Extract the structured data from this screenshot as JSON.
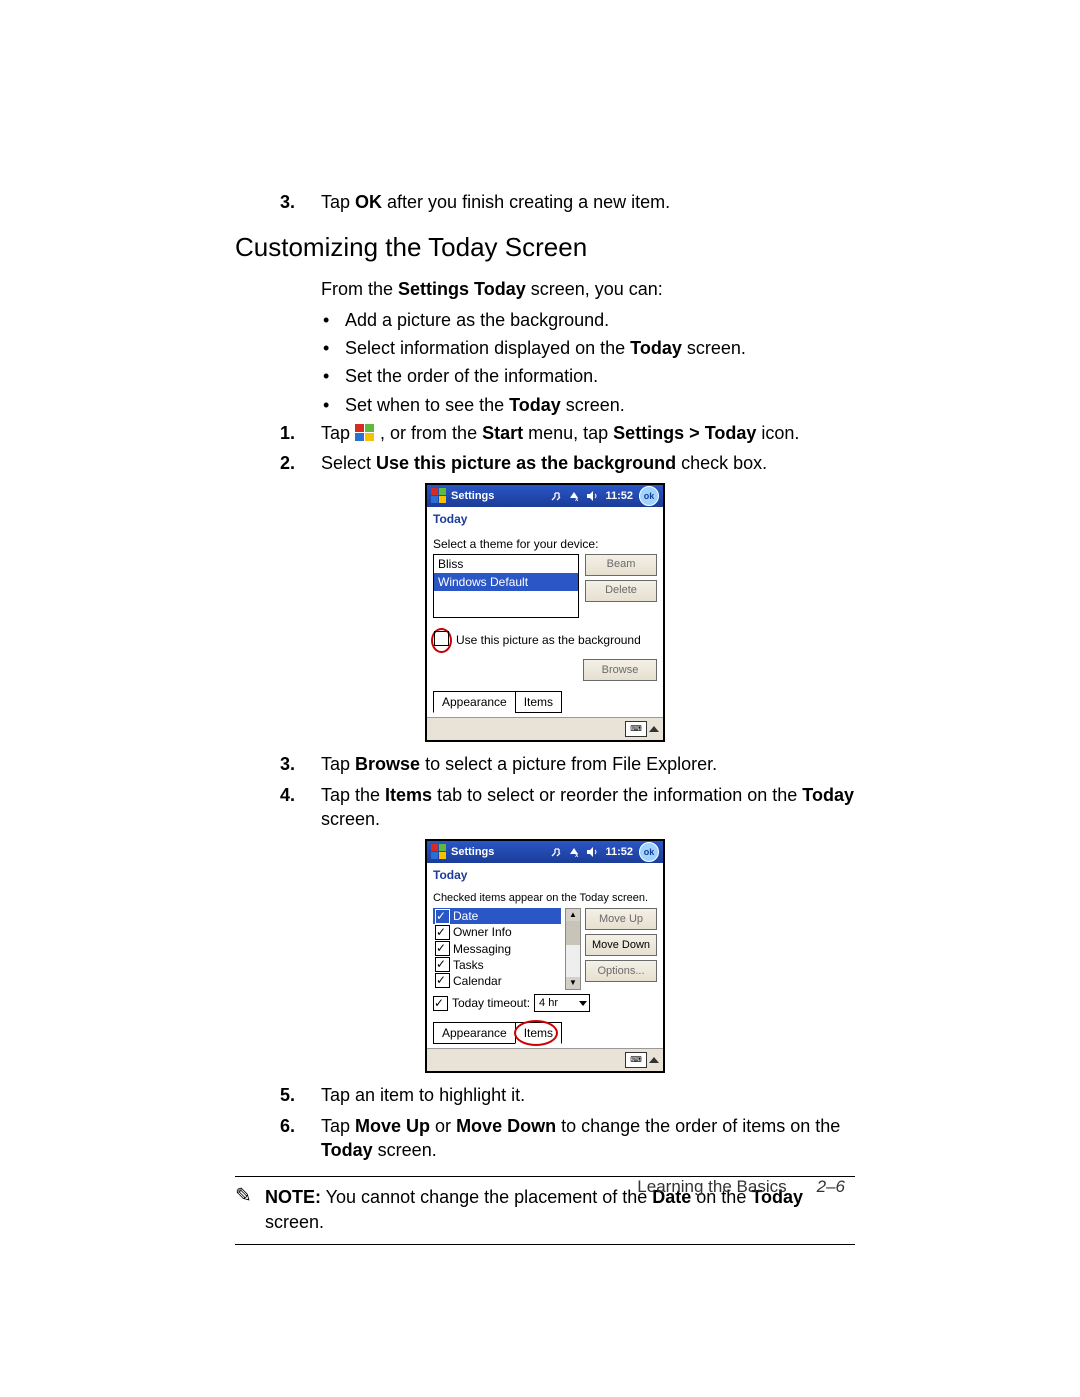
{
  "steps_top": {
    "s3_a": "Tap ",
    "s3_b": "OK",
    "s3_c": " after you finish creating a new item."
  },
  "heading": "Customizing the Today Screen",
  "intro_a": "From the ",
  "intro_b": "Settings Today",
  "intro_c": " screen, you can:",
  "bullets": {
    "b1": "Add a picture as the background.",
    "b2_a": "Select information displayed on the ",
    "b2_b": "Today",
    "b2_c": " screen.",
    "b3": "Set the order of the information.",
    "b4_a": "Set when to see the ",
    "b4_b": "Today",
    "b4_c": " screen."
  },
  "steps_mid": {
    "s1_a": "Tap ",
    "s1_b": ", or from the ",
    "s1_c": "Start",
    "s1_d": " menu, tap ",
    "s1_e": "Settings > Today",
    "s1_f": " icon.",
    "s2_a": "Select ",
    "s2_b": "Use this picture as the background",
    "s2_c": " check box."
  },
  "device1": {
    "title": "Settings",
    "clock": "11:52",
    "ok": "ok",
    "subtitle": "Today",
    "prompt": "Select a theme for your device:",
    "themes": [
      "Bliss",
      "Windows Default"
    ],
    "btn_beam": "Beam",
    "btn_delete": "Delete",
    "chk_label": "Use this picture as the background",
    "btn_browse": "Browse",
    "tab_appearance": "Appearance",
    "tab_items": "Items"
  },
  "steps_after1": {
    "s3_a": "Tap ",
    "s3_b": "Browse",
    "s3_c": " to select a picture from File Explorer.",
    "s4_a": "Tap the ",
    "s4_b": "Items",
    "s4_c": " tab to select or reorder the information on the ",
    "s4_d": "Today",
    "s4_e": " screen."
  },
  "device2": {
    "title": "Settings",
    "clock": "11:52",
    "ok": "ok",
    "subtitle": "Today",
    "prompt": "Checked items appear on the Today screen.",
    "items": [
      "Date",
      "Owner Info",
      "Messaging",
      "Tasks",
      "Calendar"
    ],
    "btn_moveup": "Move Up",
    "btn_movedown": "Move Down",
    "btn_options": "Options...",
    "timeout_label": "Today timeout:",
    "timeout_value": "4 hr",
    "tab_appearance": "Appearance",
    "tab_items": "Items"
  },
  "steps_after2": {
    "s5": "Tap an item to highlight it.",
    "s6_a": "Tap ",
    "s6_b": "Move Up",
    "s6_c": " or ",
    "s6_d": "Move Down",
    "s6_e": " to change the order of items on the ",
    "s6_f": "Today",
    "s6_g": " screen."
  },
  "note": {
    "label": "NOTE:",
    "a": "  You cannot change the placement of the ",
    "b": "Date",
    "c": " on the ",
    "d": "Today",
    "e": " screen."
  },
  "footer": {
    "section": "Learning the Basics",
    "page": "2–6"
  }
}
